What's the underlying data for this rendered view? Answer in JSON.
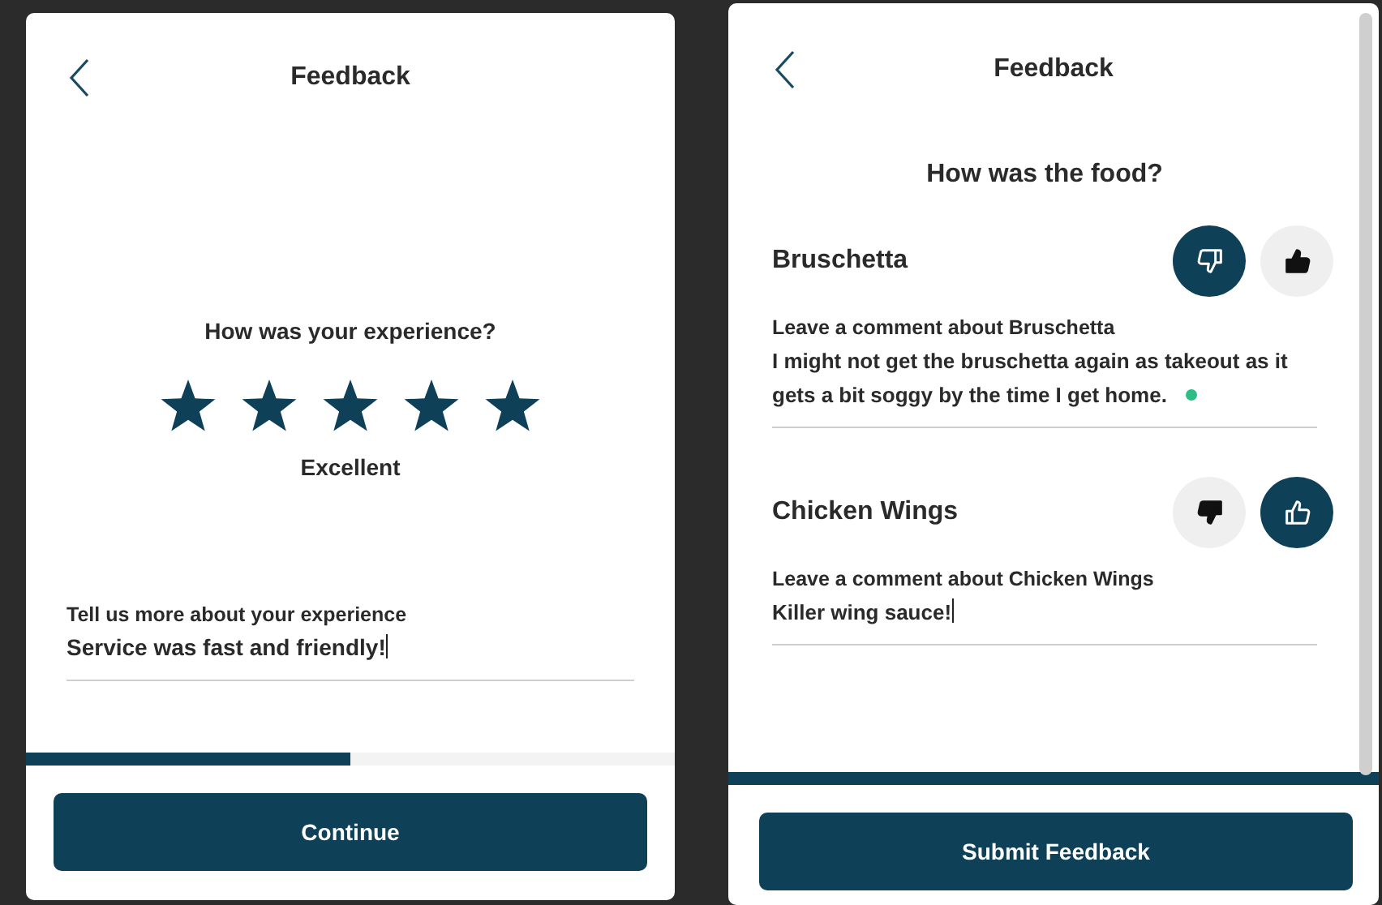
{
  "screens": [
    {
      "kind": "rating",
      "title": "Feedback",
      "question": "How was your experience?",
      "stars": 5,
      "rating_label": "Excellent",
      "comment": {
        "label": "Tell us more about your experience",
        "value": "Service was fast and friendly!",
        "focused": true,
        "status_dot": false
      },
      "progress": {
        "level": 0.5
      },
      "button": "Continue"
    },
    {
      "kind": "items",
      "title": "Feedback",
      "question": "How was the food?",
      "items": [
        {
          "name": "Bruschetta",
          "thumbs_down": true,
          "thumbs_up": false,
          "comment": {
            "label": "Leave a comment about Bruschetta",
            "value": "I might not get the bruschetta again as takeout as it gets a bit soggy by the time I get home.",
            "focused": false,
            "status_dot": true
          }
        },
        {
          "name": "Chicken Wings",
          "thumbs_down": false,
          "thumbs_up": true,
          "comment": {
            "label": "Leave a comment about Chicken Wings",
            "value": "Killer wing sauce!",
            "focused": true,
            "status_dot": false
          }
        }
      ],
      "progress": {
        "level": 1
      },
      "button": "Submit Feedback"
    }
  ]
}
